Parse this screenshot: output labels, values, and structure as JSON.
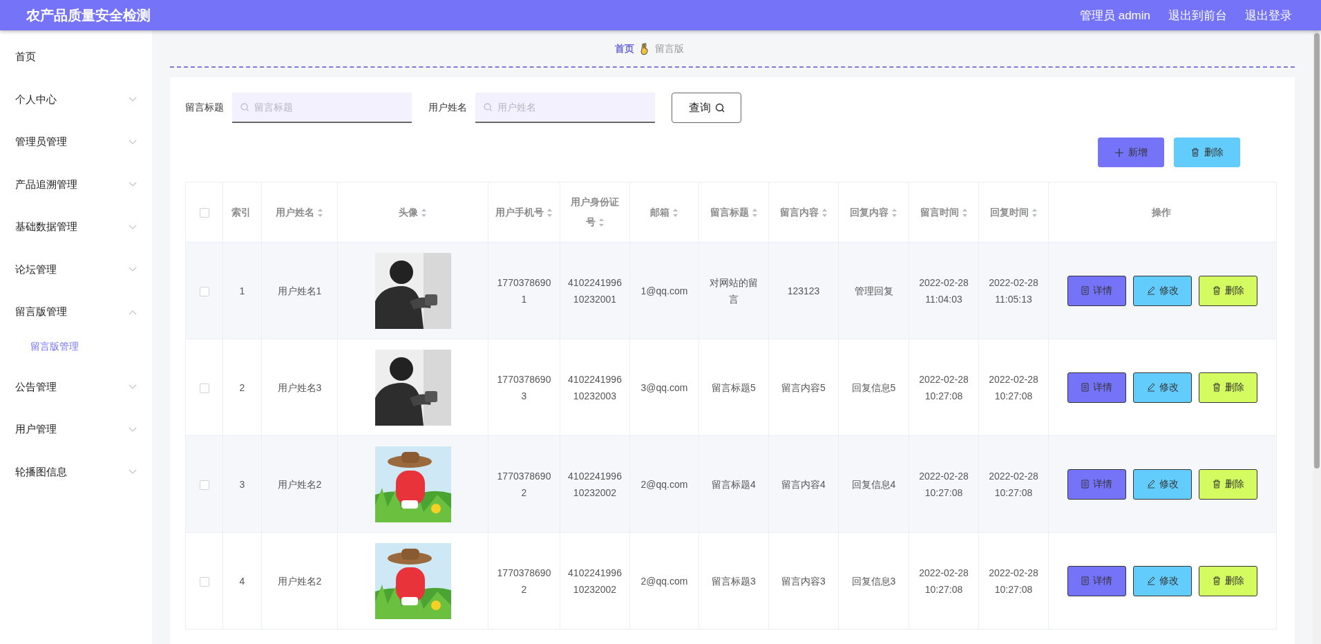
{
  "header": {
    "title": "农产品质量安全检测",
    "links": [
      "管理员 admin",
      "退出到前台",
      "退出登录"
    ]
  },
  "sidebar": {
    "items": [
      {
        "label": "首页"
      },
      {
        "label": "个人中心",
        "expanded": false
      },
      {
        "label": "管理员管理",
        "expanded": false
      },
      {
        "label": "产品追溯管理",
        "expanded": false
      },
      {
        "label": "基础数据管理",
        "expanded": false
      },
      {
        "label": "论坛管理",
        "expanded": false
      },
      {
        "label": "留言版管理",
        "expanded": true,
        "children": [
          {
            "label": "留言版管理",
            "selected": true
          }
        ]
      },
      {
        "label": "公告管理",
        "expanded": false
      },
      {
        "label": "用户管理",
        "expanded": false
      },
      {
        "label": "轮播图信息",
        "expanded": false
      }
    ]
  },
  "breadcrumb": [
    "首页",
    "留言版"
  ],
  "search": {
    "fields": [
      {
        "label": "留言标题",
        "placeholder": "留言标题"
      },
      {
        "label": "用户姓名",
        "placeholder": "用户姓名"
      }
    ],
    "button": "查询"
  },
  "actions": [
    {
      "kind": "add",
      "label": "新增"
    },
    {
      "kind": "delete",
      "label": "删除"
    }
  ],
  "table": {
    "all_checked": false,
    "columns": [
      {
        "label": "索引",
        "sortable": false
      },
      {
        "label": "用户姓名",
        "sortable": true
      },
      {
        "label": "头像",
        "sortable": true
      },
      {
        "label": "用户手机号",
        "sortable": true
      },
      {
        "label": "用户身份证号",
        "sortable": true
      },
      {
        "label": "邮箱",
        "sortable": true
      },
      {
        "label": "留言标题",
        "sortable": true
      },
      {
        "label": "留言内容",
        "sortable": true
      },
      {
        "label": "回复内容",
        "sortable": true
      },
      {
        "label": "留言时间",
        "sortable": true
      },
      {
        "label": "回复时间",
        "sortable": true
      },
      {
        "label": "操作",
        "sortable": false
      }
    ],
    "rows": [
      {
        "checked": false,
        "cells": [
          "1",
          "用户姓名1",
          {
            "kind": "picture"
          },
          "17703786901",
          "410224199610232001",
          "1@qq.com",
          "对网站的留言",
          "123123",
          "管理回复",
          "2022-02-28 11:04:03",
          "2022-02-28 11:05:13"
        ],
        "buttons": [
          {
            "kind": "detail",
            "label": "详情"
          },
          {
            "kind": "edit",
            "label": "修改"
          },
          {
            "kind": "delete",
            "label": "删除"
          }
        ]
      },
      {
        "checked": false,
        "cells": [
          "2",
          "用户姓名3",
          {
            "kind": "picture"
          },
          "17703786903",
          "410224199610232003",
          "3@qq.com",
          "留言标题5",
          "留言内容5",
          "回复信息5",
          "2022-02-28 10:27:08",
          "2022-02-28 10:27:08"
        ],
        "buttons": [
          {
            "kind": "detail",
            "label": "详情"
          },
          {
            "kind": "edit",
            "label": "修改"
          },
          {
            "kind": "delete",
            "label": "删除"
          }
        ]
      },
      {
        "checked": false,
        "cells": [
          "3",
          "用户姓名2",
          {
            "kind": "picture"
          },
          "17703786902",
          "410224199610232002",
          "2@qq.com",
          "留言标题4",
          "留言内容4",
          "回复信息4",
          "2022-02-28 10:27:08",
          "2022-02-28 10:27:08"
        ],
        "buttons": [
          {
            "kind": "detail",
            "label": "详情"
          },
          {
            "kind": "edit",
            "label": "修改"
          },
          {
            "kind": "delete",
            "label": "删除"
          }
        ]
      },
      {
        "checked": false,
        "cells": [
          "4",
          "用户姓名2",
          {
            "kind": "picture"
          },
          "17703786902",
          "410224199610232002",
          "2@qq.com",
          "留言标题3",
          "留言内容3",
          "回复信息3",
          "2022-02-28 10:27:08",
          "2022-02-28 10:27:08"
        ],
        "buttons": [
          {
            "kind": "detail",
            "label": "详情"
          },
          {
            "kind": "edit",
            "label": "修改"
          },
          {
            "kind": "delete",
            "label": "删除"
          }
        ]
      }
    ]
  }
}
